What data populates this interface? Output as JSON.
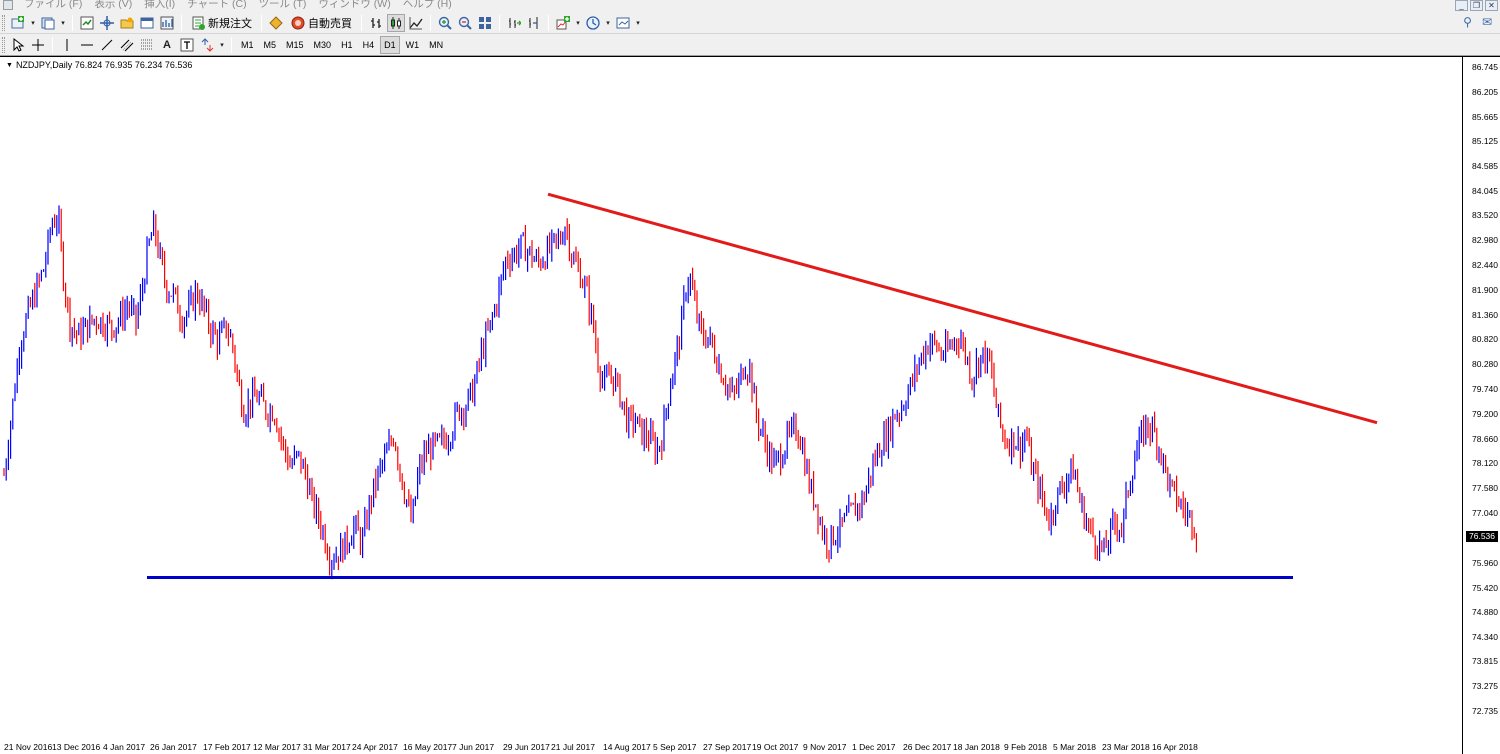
{
  "menubar": {
    "items": [
      "ファイル (F)",
      "表示 (V)",
      "挿入(I)",
      "チャート (C)",
      "ツール (T)",
      "ウィンドウ (W)",
      "ヘルプ (H)"
    ],
    "window_buttons": [
      "_",
      "❐",
      "✕"
    ]
  },
  "toolbar1": {
    "new_order_label": "新規注文",
    "auto_trade_label": "自動売買"
  },
  "toolbar2": {
    "timeframes": [
      "M1",
      "M5",
      "M15",
      "M30",
      "H1",
      "H4",
      "D1",
      "W1",
      "MN"
    ],
    "active_timeframe": "D1",
    "text_tool": "A"
  },
  "chart": {
    "symbol_info": "NZDJPY,Daily  76.824 76.935 76.234 76.536",
    "current_price": "76.536",
    "price_levels": [
      "86.745",
      "86.205",
      "85.665",
      "85.125",
      "84.585",
      "84.045",
      "83.520",
      "82.980",
      "82.440",
      "81.900",
      "81.360",
      "80.820",
      "80.280",
      "79.740",
      "79.200",
      "78.660",
      "78.120",
      "77.580",
      "77.040",
      "75.960",
      "75.420",
      "74.880",
      "74.340",
      "73.815",
      "73.275",
      "72.735"
    ],
    "date_labels": [
      "21 Nov 2016",
      "13 Dec 2016",
      "4 Jan 2017",
      "26 Jan 2017",
      "17 Feb 2017",
      "12 Mar 2017",
      "31 Mar 2017",
      "24 Apr 2017",
      "16 May 2017",
      "7 Jun 2017",
      "29 Jun 2017",
      "21 Jul 2017",
      "14 Aug 2017",
      "5 Sep 2017",
      "27 Sep 2017",
      "19 Oct 2017",
      "9 Nov 2017",
      "1 Dec 2017",
      "26 Dec 2017",
      "18 Jan 2018",
      "9 Feb 2018",
      "5 Mar 2018",
      "23 Mar 2018",
      "16 Apr 2018"
    ],
    "colors": {
      "bull": "#0000ff",
      "bear": "#ff0000",
      "trendline": "#e31a1a",
      "support": "#0000cc"
    },
    "trendline": {
      "from": {
        "date": "19 Jul 2017",
        "price": 84.0
      },
      "to": {
        "date": "29 Jun 2018",
        "price": 79.03
      }
    },
    "support_line": {
      "price": 75.66,
      "from_date": "26 Jan 2017",
      "to_date": "18 May 2018"
    }
  }
}
